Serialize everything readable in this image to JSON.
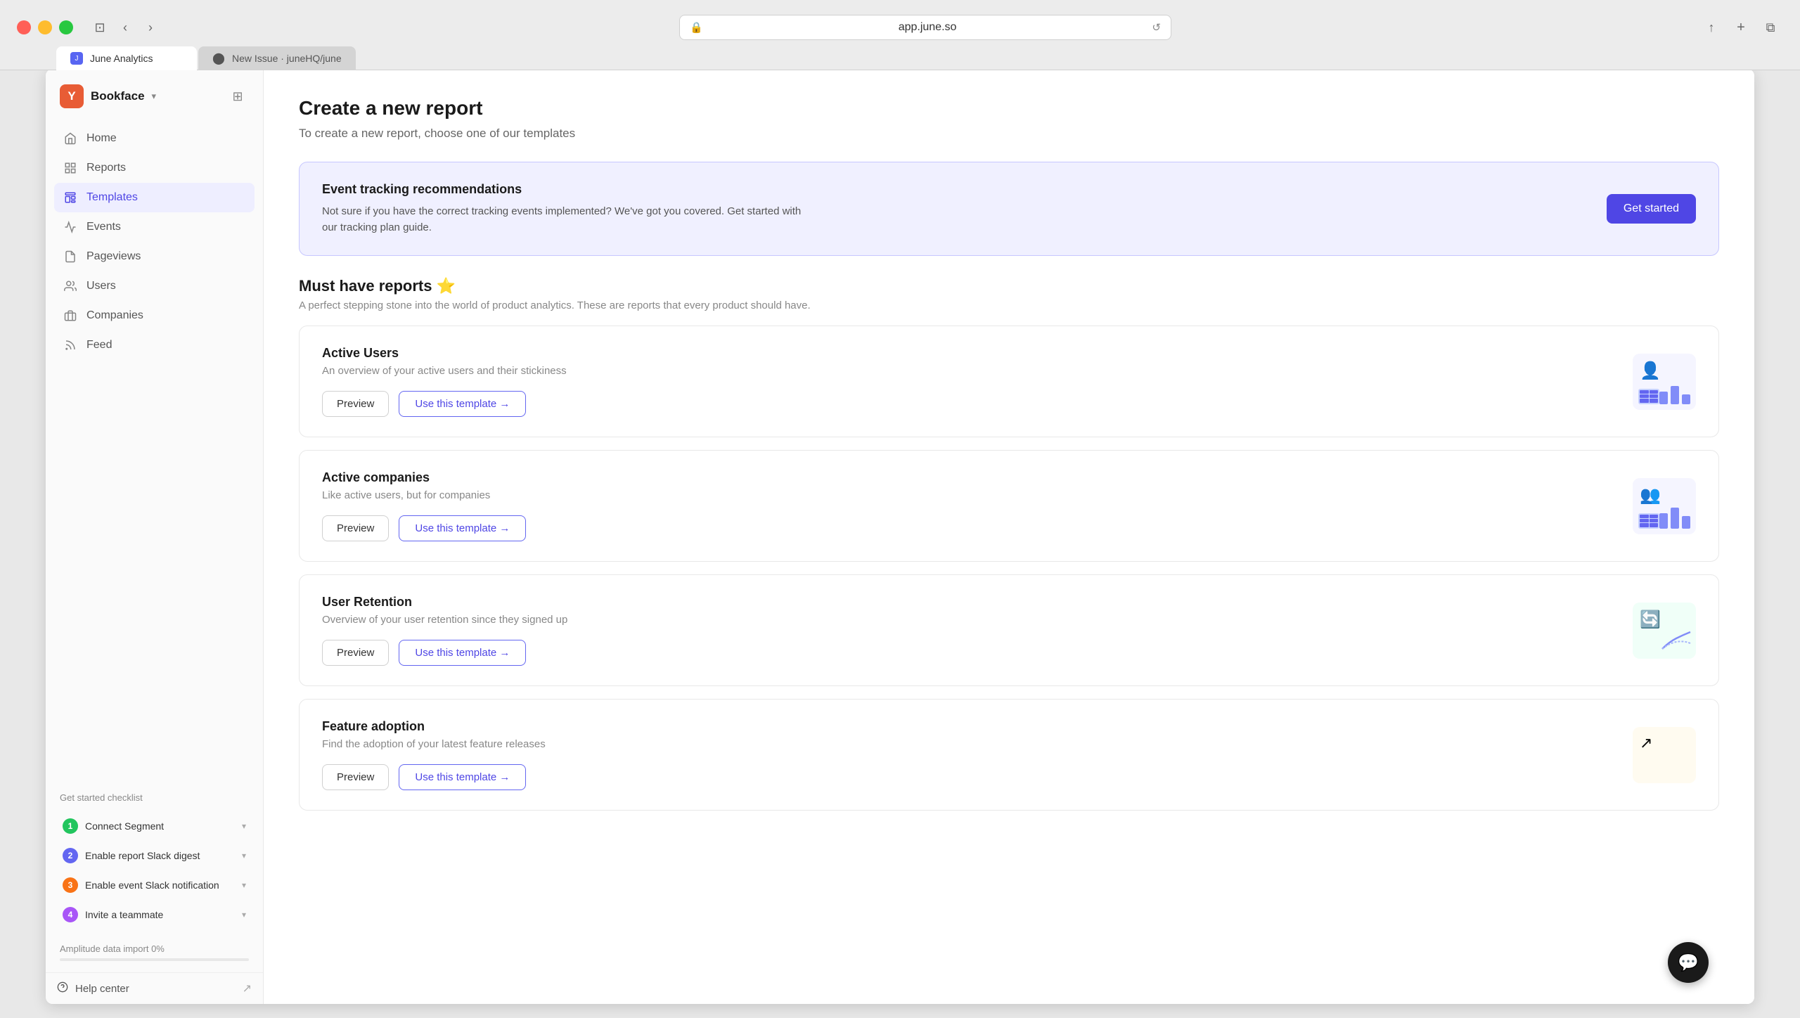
{
  "browser": {
    "url": "app.june.so",
    "tabs": [
      {
        "label": "June Analytics",
        "icon": "june",
        "active": true
      },
      {
        "label": "New Issue · juneHQ/june",
        "icon": "github",
        "active": false
      }
    ],
    "back_btn": "‹",
    "forward_btn": "›",
    "sidebar_toggle": "⊡"
  },
  "workspace": {
    "name": "Bookface",
    "icon_letter": "Y"
  },
  "sidebar": {
    "action_icon": "⊞",
    "nav_items": [
      {
        "id": "home",
        "label": "Home",
        "icon": "home"
      },
      {
        "id": "reports",
        "label": "Reports",
        "icon": "reports"
      },
      {
        "id": "templates",
        "label": "Templates",
        "icon": "templates",
        "active": true
      },
      {
        "id": "events",
        "label": "Events",
        "icon": "events"
      },
      {
        "id": "pageviews",
        "label": "Pageviews",
        "icon": "pageviews"
      },
      {
        "id": "users",
        "label": "Users",
        "icon": "users"
      },
      {
        "id": "companies",
        "label": "Companies",
        "icon": "companies"
      },
      {
        "id": "feed",
        "label": "Feed",
        "icon": "feed"
      }
    ],
    "checklist": {
      "title": "Get started checklist",
      "items": [
        {
          "num": "1",
          "label": "Connect Segment",
          "color": "green"
        },
        {
          "num": "2",
          "label": "Enable report Slack digest",
          "color": "blue"
        },
        {
          "num": "3",
          "label": "Enable event Slack notification",
          "color": "orange"
        },
        {
          "num": "4",
          "label": "Invite a teammate",
          "color": "purple"
        }
      ]
    },
    "progress": {
      "label": "Amplitude data import 0%",
      "value": 0
    },
    "help_center": "Help center"
  },
  "main": {
    "page_title": "Create a new report",
    "page_subtitle": "To create a new report, choose one of our templates",
    "banner": {
      "title": "Event tracking recommendations",
      "description": "Not sure if you have the correct tracking events implemented? We've got you covered. Get started with our tracking plan guide.",
      "cta_label": "Get started"
    },
    "section_title": "Must have reports ⭐",
    "section_desc": "A perfect stepping stone into the world of product analytics. These are reports that every product should have.",
    "reports": [
      {
        "id": "active-users",
        "title": "Active Users",
        "description": "An overview of your active users and their stickiness",
        "preview_label": "Preview",
        "use_template_label": "Use this template →"
      },
      {
        "id": "active-companies",
        "title": "Active companies",
        "description": "Like active users, but for companies",
        "preview_label": "Preview",
        "use_template_label": "Use this template →"
      },
      {
        "id": "user-retention",
        "title": "User Retention",
        "description": "Overview of your user retention since they signed up",
        "preview_label": "Preview",
        "use_template_label": "Use this template →"
      },
      {
        "id": "feature-adoption",
        "title": "Feature adoption",
        "description": "Find the adoption of your latest feature releases",
        "preview_label": "Preview",
        "use_template_label": "Use this template →"
      }
    ]
  }
}
